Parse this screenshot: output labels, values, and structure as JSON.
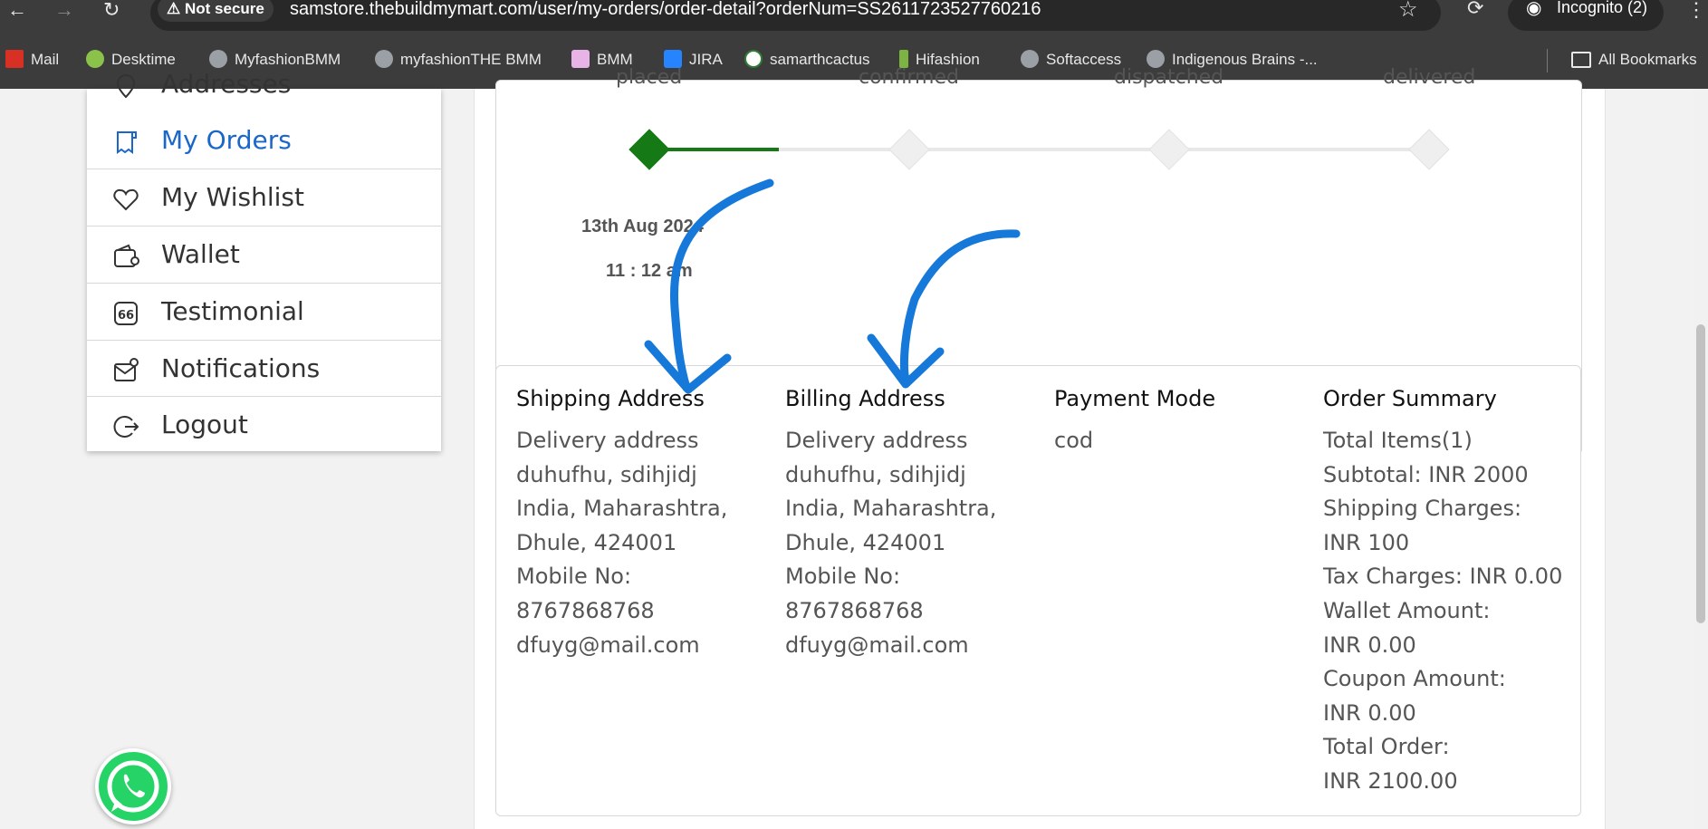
{
  "browser": {
    "not_secure": "Not secure",
    "url": "samstore.thebuildmymart.com/user/my-orders/order-detail?orderNum=SS2611723527760216",
    "incognito": "Incognito (2)",
    "bookmarks": [
      "Mail",
      "Desktime",
      "MyfashionBMM",
      "myfashionTHE BMM",
      "BMM",
      "JIRA",
      "samarthcactus",
      "Hifashion",
      "Softaccess",
      "Indigenous Brains -..."
    ],
    "all_bookmarks": "All Bookmarks"
  },
  "sidebar": {
    "items": [
      {
        "label": "Addresses",
        "icon": "location-icon"
      },
      {
        "label": "My Orders",
        "icon": "receipt-icon"
      },
      {
        "label": "My Wishlist",
        "icon": "heart-icon"
      },
      {
        "label": "Wallet",
        "icon": "wallet-icon"
      },
      {
        "label": "Testimonial",
        "icon": "quote-icon"
      },
      {
        "label": "Notifications",
        "icon": "mail-icon"
      },
      {
        "label": "Logout",
        "icon": "logout-icon"
      }
    ]
  },
  "tracker": {
    "steps": [
      {
        "label": "placed",
        "done": true
      },
      {
        "label": "confirmed",
        "done": false
      },
      {
        "label": "dispatched",
        "done": false
      },
      {
        "label": "delivered",
        "done": false
      }
    ],
    "date": "13th Aug 2024",
    "time": "11 : 12 am"
  },
  "shipping": {
    "title": "Shipping Address",
    "lines": [
      "Delivery address",
      "duhufhu, sdihjidj",
      "India, Maharashtra,",
      "Dhule, 424001",
      "Mobile No:",
      "8767868768",
      "dfuyg@mail.com"
    ]
  },
  "billing": {
    "title": "Billing Address",
    "lines": [
      "Delivery address",
      "duhufhu, sdihjidj",
      "India, Maharashtra,",
      "Dhule, 424001",
      "Mobile No:",
      "8767868768",
      "dfuyg@mail.com"
    ]
  },
  "payment": {
    "title": "Payment Mode",
    "lines": [
      "cod"
    ]
  },
  "summary": {
    "title": "Order Summary",
    "lines": [
      "Total Items(1)",
      "Subtotal: INR 2000",
      "Shipping Charges:",
      "INR 100",
      "Tax Charges: INR 0.00",
      "Wallet Amount:",
      "INR 0.00",
      "Coupon Amount:",
      "INR 0.00",
      "Total Order:",
      "INR 2100.00"
    ]
  },
  "colors": {
    "accent": "#1a66c9",
    "done": "#157a15",
    "annotation": "#1678d8",
    "whatsapp": "#25d366"
  }
}
